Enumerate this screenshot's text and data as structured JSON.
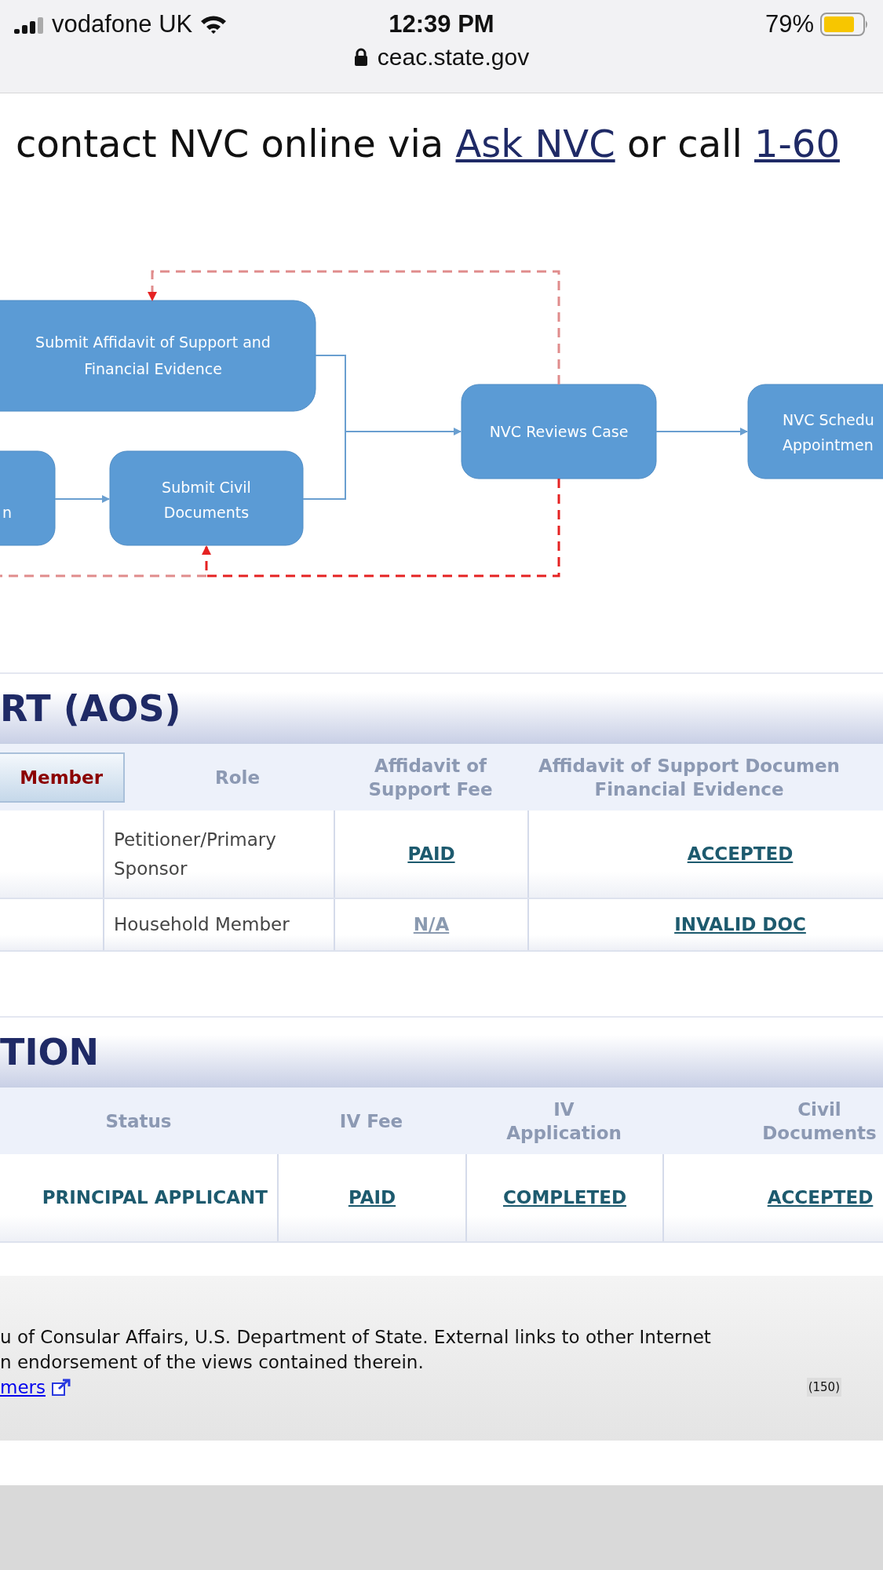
{
  "status_bar": {
    "carrier": "vodafone UK",
    "time": "12:39 PM",
    "battery": "79%",
    "url": "ceac.state.gov"
  },
  "intro": {
    "line_2": [
      {
        "kind": "text",
        "text": "contact NVC online via "
      },
      {
        "kind": "link",
        "text": "Ask NVC"
      },
      {
        "kind": "text",
        "text": " or call "
      },
      {
        "kind": "link",
        "text": "1-60"
      }
    ]
  },
  "diagram": {
    "steps": [
      {
        "lines": [
          "Submit Affidavit of Support and",
          "Financial Evidence"
        ]
      },
      {
        "lines": [
          "n"
        ]
      },
      {
        "lines": [
          "Submit Civil",
          "Documents"
        ]
      },
      {
        "lines": [
          "NVC Reviews Case"
        ]
      },
      {
        "lines": [
          "NVC Schedu",
          "Appointmen"
        ]
      }
    ]
  },
  "sections": [
    {
      "title": "RT (AOS)",
      "columns": [
        {
          "kind": "button",
          "label": "Member"
        },
        {
          "kind": "text",
          "label": "Role"
        },
        {
          "kind": "text",
          "label": "Affidavit of\nSupport Fee"
        },
        {
          "kind": "text",
          "label": "Affidavit of Support Documen\nFinancial Evidence"
        }
      ],
      "rows": [
        {
          "cells": [
            {
              "kind": "blank"
            },
            {
              "kind": "text",
              "text": "Petitioner/Primary Sponsor"
            },
            {
              "kind": "link",
              "text": "PAID"
            },
            {
              "kind": "link",
              "text": "ACCEPTED"
            }
          ]
        },
        {
          "cells": [
            {
              "kind": "blank"
            },
            {
              "kind": "text",
              "text": "Household Member"
            },
            {
              "kind": "inactive_link",
              "text": "N/A"
            },
            {
              "kind": "link",
              "text": "INVALID DOC"
            }
          ]
        }
      ]
    },
    {
      "title": "TION",
      "columns": [
        {
          "kind": "text",
          "label": "Status"
        },
        {
          "kind": "text",
          "label": "IV Fee"
        },
        {
          "kind": "text",
          "label": "IV\nApplication"
        },
        {
          "kind": "text",
          "label": "Civil\nDocuments"
        }
      ],
      "rows": [
        {
          "cells": [
            {
              "kind": "status",
              "text": "PRINCIPAL APPLICANT"
            },
            {
              "kind": "link",
              "text": "PAID"
            },
            {
              "kind": "link",
              "text": "COMPLETED"
            },
            {
              "kind": "link",
              "text": "ACCEPTED"
            }
          ]
        }
      ]
    }
  ],
  "footer": {
    "lines": [
      "u of Consular Affairs, U.S. Department of State. External links to other Internet",
      "n endorsement of the views contained therein."
    ],
    "link": "mers",
    "counter": "(150)"
  }
}
